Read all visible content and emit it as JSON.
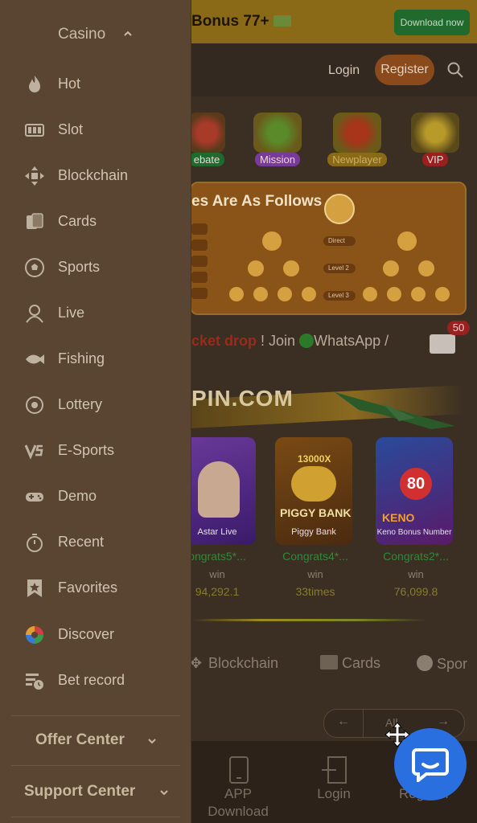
{
  "banner": {
    "text": "Bonus 77+",
    "download_label": "Download now"
  },
  "header": {
    "login": "Login",
    "register": "Register"
  },
  "quick_links": [
    {
      "label": "ebate",
      "color": "#1f6a2c"
    },
    {
      "label": "Mission",
      "color": "#7a3a9a"
    },
    {
      "label": "Newplayer",
      "color": "#8a6a16"
    },
    {
      "label": "VIP",
      "color": "#9a2020"
    }
  ],
  "promo": {
    "title": "es Are As Follows",
    "levels": [
      "Direct",
      "Level 2",
      "Level 3"
    ]
  },
  "marquee": {
    "highlight": "cket drop",
    "rest": "! Join",
    "whatsapp": "WhatsApp /"
  },
  "mail": {
    "badge": "50"
  },
  "site_logo": "PIN.COM",
  "games": [
    {
      "name": "Astar Live",
      "title": "",
      "congrats": "ongrats5*...",
      "win": "win",
      "value": "94,292.1"
    },
    {
      "name": "Piggy Bank",
      "title": "PIGGY BANK",
      "multiplier": "13000X",
      "congrats": "Congrats4*...",
      "win": "win",
      "value": "33times"
    },
    {
      "name": "Keno Bonus Number",
      "title": "KENO",
      "number": "80",
      "congrats": "Congrats2*...",
      "win": "win",
      "value": "76,099.8"
    }
  ],
  "categories": [
    "Blockchain",
    "Cards",
    "Spor"
  ],
  "pager": {
    "center": "All"
  },
  "bottom_nav": {
    "app": "APP",
    "download": "Download",
    "login": "Login",
    "register": "Register"
  },
  "sidebar": {
    "header": "Casino",
    "items": [
      {
        "label": "Hot",
        "icon": "fire-icon"
      },
      {
        "label": "Slot",
        "icon": "slot-icon"
      },
      {
        "label": "Blockchain",
        "icon": "blockchain-icon"
      },
      {
        "label": "Cards",
        "icon": "cards-icon"
      },
      {
        "label": "Sports",
        "icon": "soccer-ball-icon"
      },
      {
        "label": "Live",
        "icon": "live-dealer-icon"
      },
      {
        "label": "Fishing",
        "icon": "fish-icon"
      },
      {
        "label": "Lottery",
        "icon": "lottery-icon"
      },
      {
        "label": "E-Sports",
        "icon": "esports-icon"
      },
      {
        "label": "Demo",
        "icon": "gamepad-icon"
      },
      {
        "label": "Recent",
        "icon": "stopwatch-icon"
      },
      {
        "label": "Favorites",
        "icon": "star-bookmark-icon"
      },
      {
        "label": "Discover",
        "icon": "discover-icon"
      },
      {
        "label": "Bet record",
        "icon": "bet-record-icon"
      }
    ],
    "offer_center": "Offer Center",
    "support_center": "Support Center"
  }
}
